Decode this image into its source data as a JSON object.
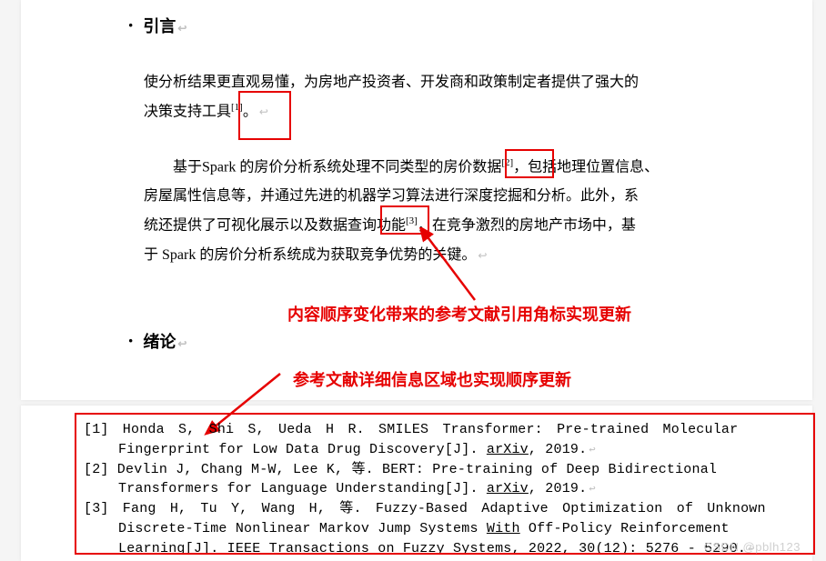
{
  "headings": {
    "intro": "引言",
    "discussion": "绪论"
  },
  "paragraphs": {
    "p1_a": "使分析结果更直观易懂，为房地产投资者、开发商和政策制定者提供了强大的",
    "p1_b_pre": "决策支持工具",
    "p1_b_sup": "[1]",
    "p1_b_post": "。",
    "p2_a_pre": "基于Spark 的房价分析系统处理不同类型的房价数据",
    "p2_a_sup": "[2]",
    "p2_a_post": "，包括地理位置信息、",
    "p2_b": "房屋属性信息等，并通过先进的机器学习算法进行深度挖掘和分析。此外，系",
    "p2_c_pre": "统还提供了可视化展示以及数据查询功能",
    "p2_c_sup": "[3]",
    "p2_c_post": "，在竞争激烈的房地产市场中，基",
    "p2_d": "于 Spark 的房价分析系统成为获取竞争优势的关键。"
  },
  "annotations": {
    "anno1": "内容顺序变化带来的参考文献引用角标实现更新",
    "anno2": "参考文献详细信息区域也实现顺序更新"
  },
  "references": {
    "r1_a": "[1] Honda  S,  Shi  S,  Ueda  H  R.  SMILES  Transformer:  Pre-trained  Molecular",
    "r1_b_pre": "Fingerprint for Low Data Drug Discovery[J]. ",
    "r1_b_u": "arXiv",
    "r1_b_post": ", 2019.",
    "r2_a": "[2] Devlin J, Chang M-W, Lee K, 等. BERT: Pre-training of Deep Bidirectional",
    "r2_b_pre": "Transformers for Language Understanding[J]. ",
    "r2_b_u": "arXiv",
    "r2_b_post": ", 2019.",
    "r3_a": "[3] Fang H,  Tu Y,  Wang H,  等.  Fuzzy-Based  Adaptive  Optimization  of  Unknown",
    "r3_b_pre": "Discrete-Time Nonlinear Markov Jump Systems ",
    "r3_b_u": "With",
    "r3_b_post": " Off-Policy Reinforcement",
    "r3_c": "Learning[J]. IEEE Transactions on Fuzzy Systems, 2022, 30(12): 5276 - 5290."
  },
  "watermark": "CSDN @pblh123"
}
